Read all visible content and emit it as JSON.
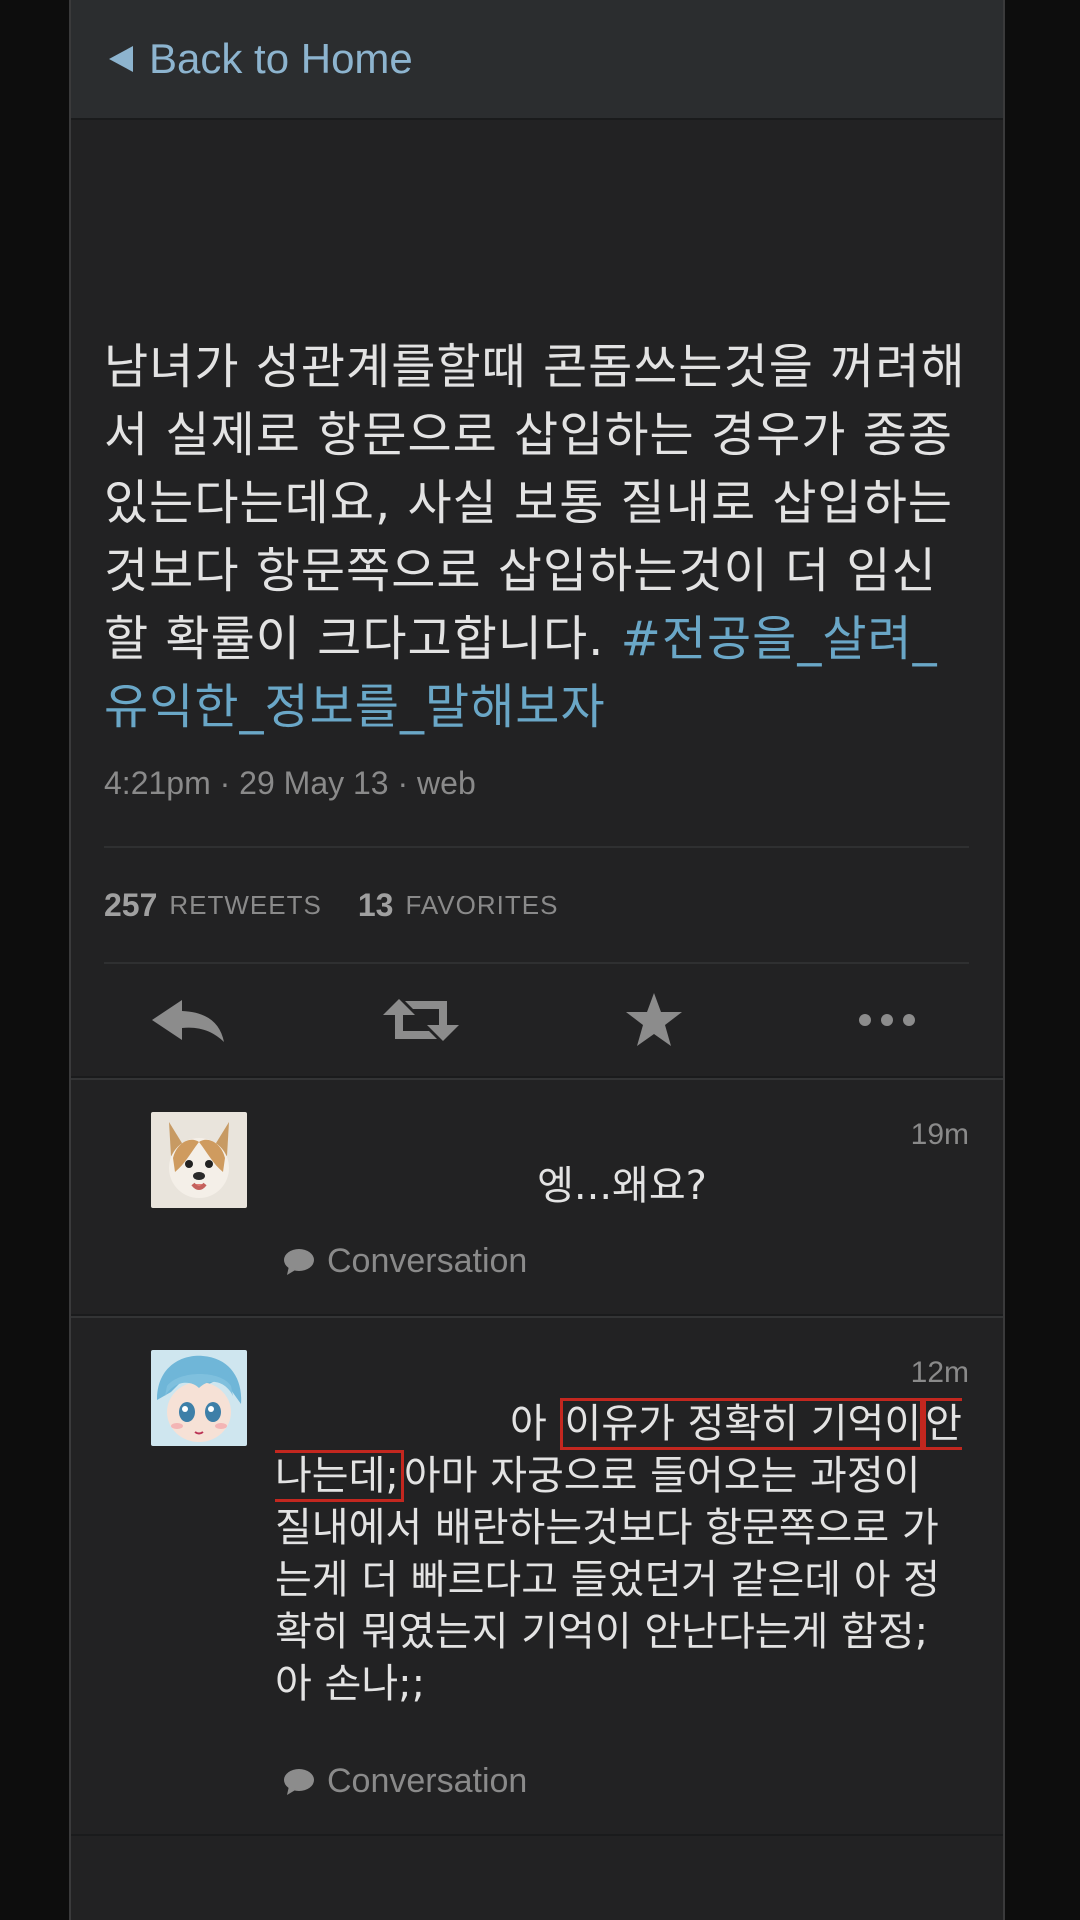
{
  "nav": {
    "back_label": "Back to Home"
  },
  "tweet": {
    "text": "남녀가 성관계를할때 콘돔쓰는것을 꺼려해서 실제로 항문으로 삽입하는 경우가 종종 있는다는데요, 사실 보통 질내로 삽입하는것보다 항문쪽으로 삽입하는것이 더 임신할 확률이 크다고합니다. ",
    "hashtag": "#전공을_살려_유익한_정보를_말해보자",
    "meta": "4:21pm · 29 May 13 · web",
    "retweets_count": "257",
    "retweets_label": "RETWEETS",
    "favorites_count": "13",
    "favorites_label": "FAVORITES"
  },
  "actions": {
    "reply_icon": "reply-icon",
    "retweet_icon": "retweet-icon",
    "favorite_icon": "star-icon",
    "more_icon": "more-icon"
  },
  "replies": [
    {
      "time": "19m",
      "text": "엥...왜요?",
      "conversation_label": "Conversation"
    },
    {
      "time": "12m",
      "text_prefix": "아 ",
      "text_highlight_1": "이유가 정확히 기억이",
      "text_highlight_2": "안나는데;",
      "text_rest": "아마 자궁으로 들어오는 과정이 질내에서 배란하는것보다 항문쪽으로 가는게 더 빠르다고 들었던거 같은데 아 정확히 뭐였는지 기억이 안난다는게 함정; 아 손나;;",
      "conversation_label": "Conversation"
    }
  ],
  "colors": {
    "background": "#222223",
    "link": "#8db4cf",
    "hashtag": "#6aa7c7",
    "highlight_box": "#c3271f"
  }
}
